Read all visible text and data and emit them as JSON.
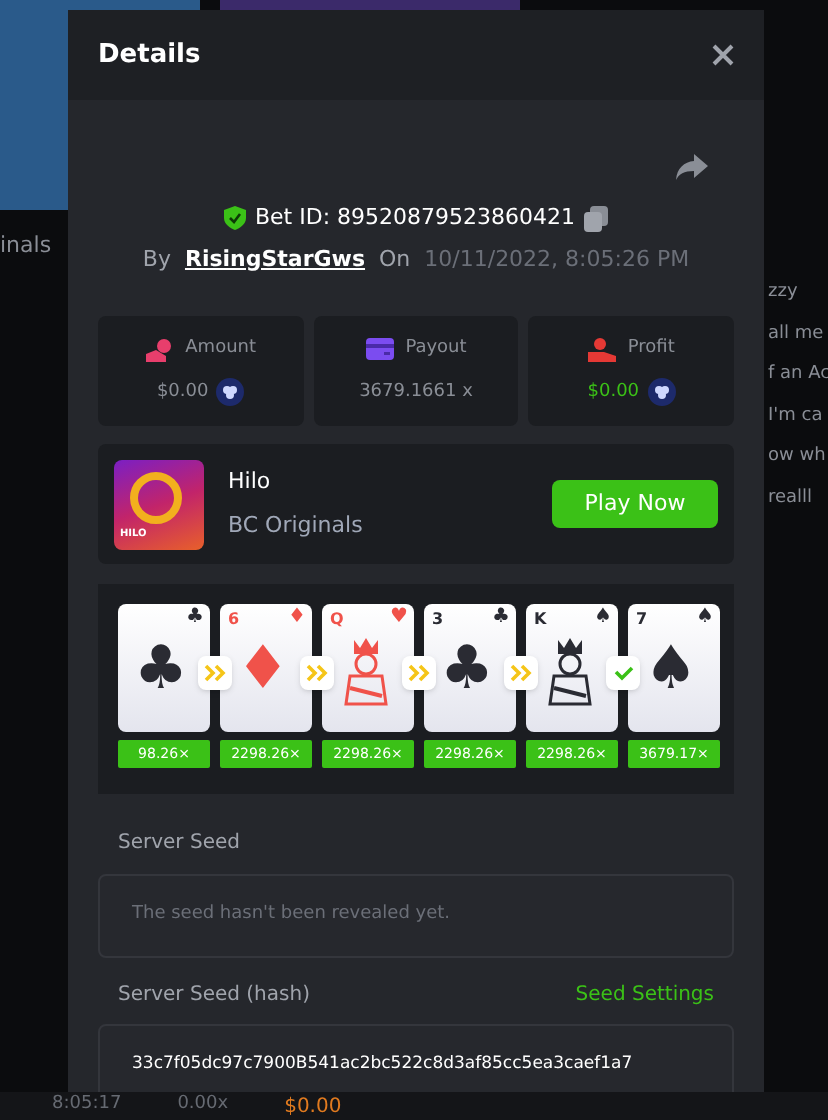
{
  "background": {
    "left_text": "inals",
    "right_texts": [
      "zzy",
      "all me",
      "f an Ac",
      "I'm ca",
      "ow wh",
      "realll"
    ],
    "time": "8:05:17",
    "bottom_multiplier": "0.00x",
    "bottom_amount": "$0.00"
  },
  "dialog": {
    "title": "Details",
    "bet_id": "Bet ID: 89520879523860421",
    "by_label": "By",
    "user": "RisingStarGws",
    "on_label": "On",
    "date": "10/11/2022, 8:05:26 PM",
    "stats": [
      {
        "kind": "amount",
        "label": "Amount",
        "value": "$0.00",
        "positive": false,
        "coin": true
      },
      {
        "kind": "payout",
        "label": "Payout",
        "value": "3679.1661 x",
        "positive": false,
        "coin": false
      },
      {
        "kind": "profit",
        "label": "Profit",
        "value": "$0.00",
        "positive": true,
        "coin": true
      }
    ],
    "game": {
      "name": "Hilo",
      "provider": "BC Originals",
      "thumb_label": "HILO",
      "button": "Play Now"
    },
    "cards": [
      {
        "suit": "♣",
        "red": false,
        "face": false,
        "multiplier": "98.26×",
        "kind": "higher"
      },
      {
        "rank": "6",
        "suit": "♦",
        "red": true,
        "face": false,
        "multiplier": "2298.26×",
        "kind": "higher"
      },
      {
        "rank": "Q",
        "suit": "♥",
        "red": true,
        "face": true,
        "multiplier": "2298.26×",
        "kind": "higher"
      },
      {
        "rank": "3",
        "suit": "♣",
        "red": false,
        "face": false,
        "multiplier": "2298.26×",
        "kind": "higher"
      },
      {
        "rank": "K",
        "suit": "♠",
        "red": false,
        "face": true,
        "multiplier": "2298.26×",
        "kind": "correct"
      },
      {
        "rank": "7",
        "suit": "♠",
        "red": false,
        "face": false,
        "multiplier": "3679.17×",
        "kind": "last"
      }
    ],
    "server_seed": {
      "label": "Server Seed",
      "text": "The seed hasn't been revealed yet."
    },
    "seed_hash": {
      "label": "Server Seed (hash)",
      "link": "Seed Settings",
      "value": "33c7f05dc97c7900B541ac2bc522c8d3af85cc5ea3caef1a7"
    }
  }
}
